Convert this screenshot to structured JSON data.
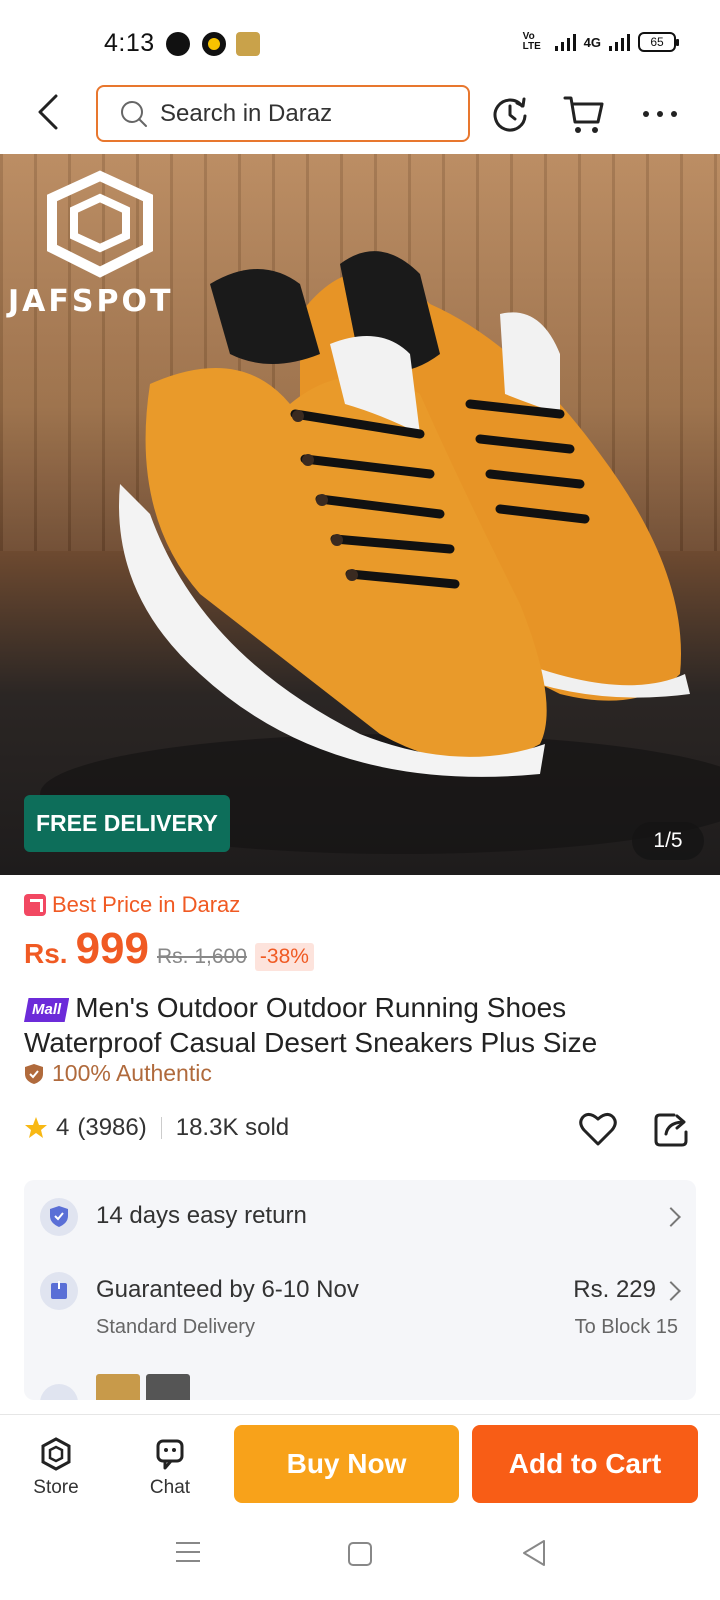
{
  "status_bar": {
    "time": "4:13",
    "volte": "Vo LTE",
    "network": "4G",
    "battery": "65"
  },
  "header": {
    "search_placeholder": "Search in Daraz"
  },
  "product_image": {
    "brand": "JAFSPOT",
    "badge": "FREE DELIVERY",
    "counter": "1/5"
  },
  "product": {
    "best_price_label": "Best Price in Daraz",
    "currency": "Rs.",
    "price": "999",
    "original_price": "Rs. 1,600",
    "discount": "-38%",
    "mall_badge": "Mall",
    "title": "Men's Outdoor Outdoor Running Shoes Waterproof Casual Desert Sneakers Plus Size",
    "authentic_label": "100% Authentic",
    "rating": "4",
    "reviews": "(3986)",
    "sold": "18.3K sold"
  },
  "services": {
    "return_label": "14 days easy return",
    "delivery_label": "Guaranteed by 6-10 Nov",
    "delivery_type": "Standard Delivery",
    "delivery_price": "Rs. 229",
    "delivery_location": "To Block 15"
  },
  "actions": {
    "store_label": "Store",
    "chat_label": "Chat",
    "buy_now_label": "Buy Now",
    "add_to_cart_label": "Add to Cart"
  },
  "colors": {
    "accent": "#f05a23",
    "buy_now": "#f8a21a",
    "add_to_cart": "#f85d16",
    "free_delivery": "#0d6e5a",
    "search_border": "#e8772e"
  }
}
